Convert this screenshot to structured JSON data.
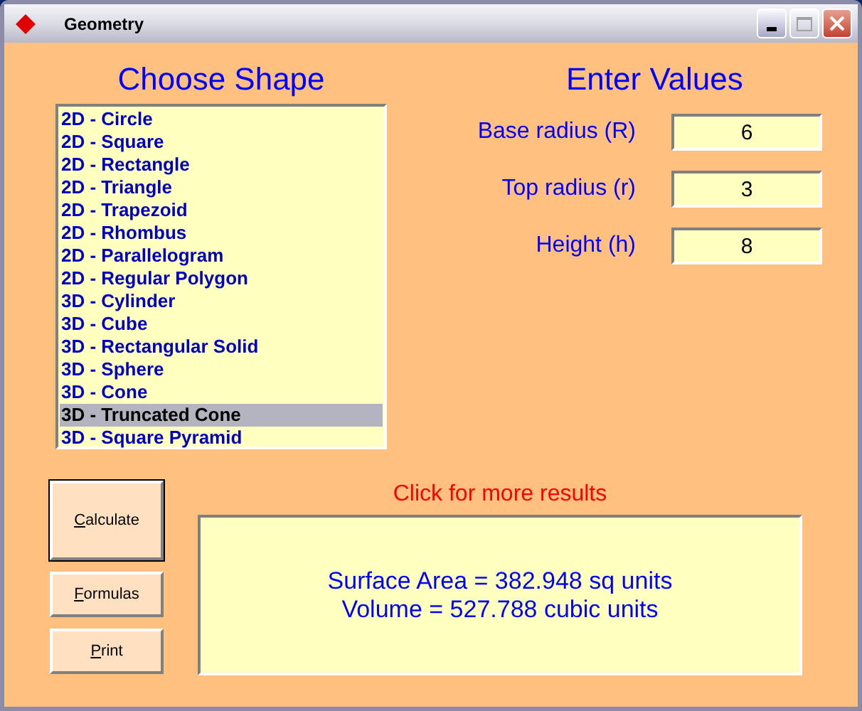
{
  "window": {
    "title": "Geometry"
  },
  "shape_heading": "Choose Shape",
  "shapes": [
    {
      "label": "2D - Circle",
      "selected": false
    },
    {
      "label": "2D - Square",
      "selected": false
    },
    {
      "label": "2D - Rectangle",
      "selected": false
    },
    {
      "label": "2D - Triangle",
      "selected": false
    },
    {
      "label": "2D - Trapezoid",
      "selected": false
    },
    {
      "label": "2D - Rhombus",
      "selected": false
    },
    {
      "label": "2D - Parallelogram",
      "selected": false
    },
    {
      "label": "2D - Regular Polygon",
      "selected": false
    },
    {
      "label": "3D - Cylinder",
      "selected": false
    },
    {
      "label": "3D - Cube",
      "selected": false
    },
    {
      "label": "3D - Rectangular Solid",
      "selected": false
    },
    {
      "label": "3D - Sphere",
      "selected": false
    },
    {
      "label": "3D - Cone",
      "selected": false
    },
    {
      "label": "3D - Truncated Cone",
      "selected": true
    },
    {
      "label": "3D - Square Pyramid",
      "selected": false
    }
  ],
  "values_heading": "Enter Values",
  "fields": [
    {
      "label": "Base radius (R)",
      "value": "6"
    },
    {
      "label": "Top radius (r)",
      "value": "3"
    },
    {
      "label": "Height (h)",
      "value": "8"
    }
  ],
  "buttons": [
    {
      "label": "Calculate",
      "default": true
    },
    {
      "label": "Formulas",
      "default": false
    },
    {
      "label": "Print",
      "default": false
    }
  ],
  "results_link": "Click for more results",
  "results": [
    "Surface Area = 382.948 sq units",
    "Volume = 527.788 cubic units"
  ]
}
